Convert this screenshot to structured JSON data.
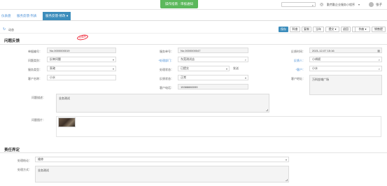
{
  "topbar": {
    "banner": "操作指南 · 审核通知",
    "search_placeholder": "",
    "site_name": "勤劳勤企业服务小程序",
    "user_name": "张子"
  },
  "tabs": [
    {
      "label": "仪表盘"
    },
    {
      "label": "服务反馈-列表"
    },
    {
      "label": "服务反馈-修改 ●"
    }
  ],
  "toolbar": {
    "label": "动态",
    "buttons": [
      "保存",
      "科查",
      "复制",
      "当年",
      "提交 ▾",
      "退回",
      "审审 ▾",
      "作废 ▾",
      "销售提"
    ]
  },
  "section1": {
    "title": "问题反馈",
    "stamp": "已保存"
  },
  "fields": {
    "feedback_no": {
      "label": "单据编号：",
      "value": "No.0000000019"
    },
    "problem_type": {
      "label": "问题类别：",
      "value": "反映问题"
    },
    "service_type": {
      "label": "服务类型：",
      "value": "家政"
    },
    "customer": {
      "label": "客户名称：",
      "value": "小水"
    },
    "service_no": {
      "label": "服务单号：",
      "value": "No.0000000047"
    },
    "handling_dept": {
      "label": "*处理部门：",
      "value": "东莞测试店"
    },
    "handling_status": {
      "label": "处理状态：",
      "value": "已提交"
    },
    "confirm": "发送",
    "feedback_status": {
      "label": "反馈状态：",
      "value": "正常"
    },
    "customer_phone": {
      "label": "客户电话：",
      "value": "15388880099"
    },
    "feedback_time": {
      "label": "反馈时间：",
      "value": "2021-12-07 15:16"
    },
    "operator": {
      "label": "反馈人：",
      "value": "小胡斌"
    },
    "handler": {
      "label": "*客户：",
      "value": "小水"
    },
    "customer_address": {
      "label": "客户地址：",
      "value": "万科金域广场"
    },
    "problem_desc": {
      "label": "问题描述：",
      "value": "业务测试"
    },
    "problem_image": {
      "label": "问题图片："
    }
  },
  "section2": {
    "title": "责任界定"
  },
  "responsibility": {
    "result": {
      "label": "处理结论：",
      "value": "维修"
    },
    "method": {
      "label": "处理方式：",
      "value": "业务测试"
    }
  },
  "colors": {
    "accent": "#3c8dbc",
    "banner": "#5cb85c",
    "link": "#4a8fd6",
    "stamp": "#e23333"
  }
}
